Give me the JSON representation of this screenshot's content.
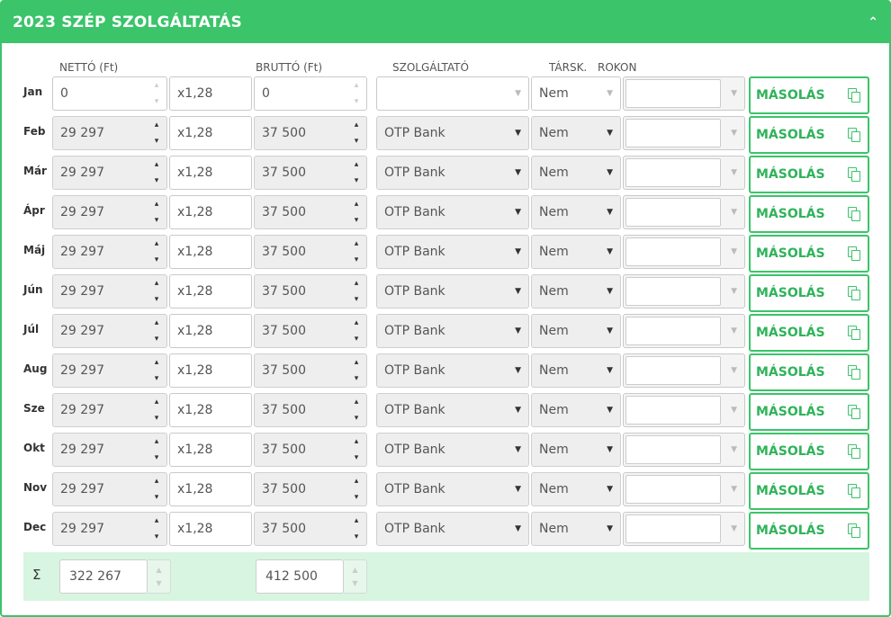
{
  "panel": {
    "title": "2023 SZÉP SZOLGÁLTATÁS",
    "accent_color": "#3bc46a",
    "collapse_icon": "chevron-up-icon"
  },
  "columns": {
    "netto": "NETTÓ (Ft)",
    "brutto": "BRUTTÓ (Ft)",
    "provider": "SZOLGÁLTATÓ",
    "tarsk": "TÁRSK.",
    "rokon": "ROKON"
  },
  "rows": [
    {
      "month": "Jan",
      "netto": "0",
      "mult": "x1,28",
      "brutto": "0",
      "provider": "",
      "tarsk": "Nem",
      "rokon": "",
      "copy": "MÁSOLÁS"
    },
    {
      "month": "Feb",
      "netto": "29 297",
      "mult": "x1,28",
      "brutto": "37 500",
      "provider": "OTP Bank",
      "tarsk": "Nem",
      "rokon": "",
      "copy": "MÁSOLÁS"
    },
    {
      "month": "Már",
      "netto": "29 297",
      "mult": "x1,28",
      "brutto": "37 500",
      "provider": "OTP Bank",
      "tarsk": "Nem",
      "rokon": "",
      "copy": "MÁSOLÁS"
    },
    {
      "month": "Ápr",
      "netto": "29 297",
      "mult": "x1,28",
      "brutto": "37 500",
      "provider": "OTP Bank",
      "tarsk": "Nem",
      "rokon": "",
      "copy": "MÁSOLÁS"
    },
    {
      "month": "Máj",
      "netto": "29 297",
      "mult": "x1,28",
      "brutto": "37 500",
      "provider": "OTP Bank",
      "tarsk": "Nem",
      "rokon": "",
      "copy": "MÁSOLÁS"
    },
    {
      "month": "Jún",
      "netto": "29 297",
      "mult": "x1,28",
      "brutto": "37 500",
      "provider": "OTP Bank",
      "tarsk": "Nem",
      "rokon": "",
      "copy": "MÁSOLÁS"
    },
    {
      "month": "Júl",
      "netto": "29 297",
      "mult": "x1,28",
      "brutto": "37 500",
      "provider": "OTP Bank",
      "tarsk": "Nem",
      "rokon": "",
      "copy": "MÁSOLÁS"
    },
    {
      "month": "Aug",
      "netto": "29 297",
      "mult": "x1,28",
      "brutto": "37 500",
      "provider": "OTP Bank",
      "tarsk": "Nem",
      "rokon": "",
      "copy": "MÁSOLÁS"
    },
    {
      "month": "Sze",
      "netto": "29 297",
      "mult": "x1,28",
      "brutto": "37 500",
      "provider": "OTP Bank",
      "tarsk": "Nem",
      "rokon": "",
      "copy": "MÁSOLÁS"
    },
    {
      "month": "Okt",
      "netto": "29 297",
      "mult": "x1,28",
      "brutto": "37 500",
      "provider": "OTP Bank",
      "tarsk": "Nem",
      "rokon": "",
      "copy": "MÁSOLÁS"
    },
    {
      "month": "Nov",
      "netto": "29 297",
      "mult": "x1,28",
      "brutto": "37 500",
      "provider": "OTP Bank",
      "tarsk": "Nem",
      "rokon": "",
      "copy": "MÁSOLÁS"
    },
    {
      "month": "Dec",
      "netto": "29 297",
      "mult": "x1,28",
      "brutto": "37 500",
      "provider": "OTP Bank",
      "tarsk": "Nem",
      "rokon": "",
      "copy": "MÁSOLÁS"
    }
  ],
  "totals": {
    "sigma": "Σ",
    "netto": "322 267",
    "brutto": "412 500"
  }
}
